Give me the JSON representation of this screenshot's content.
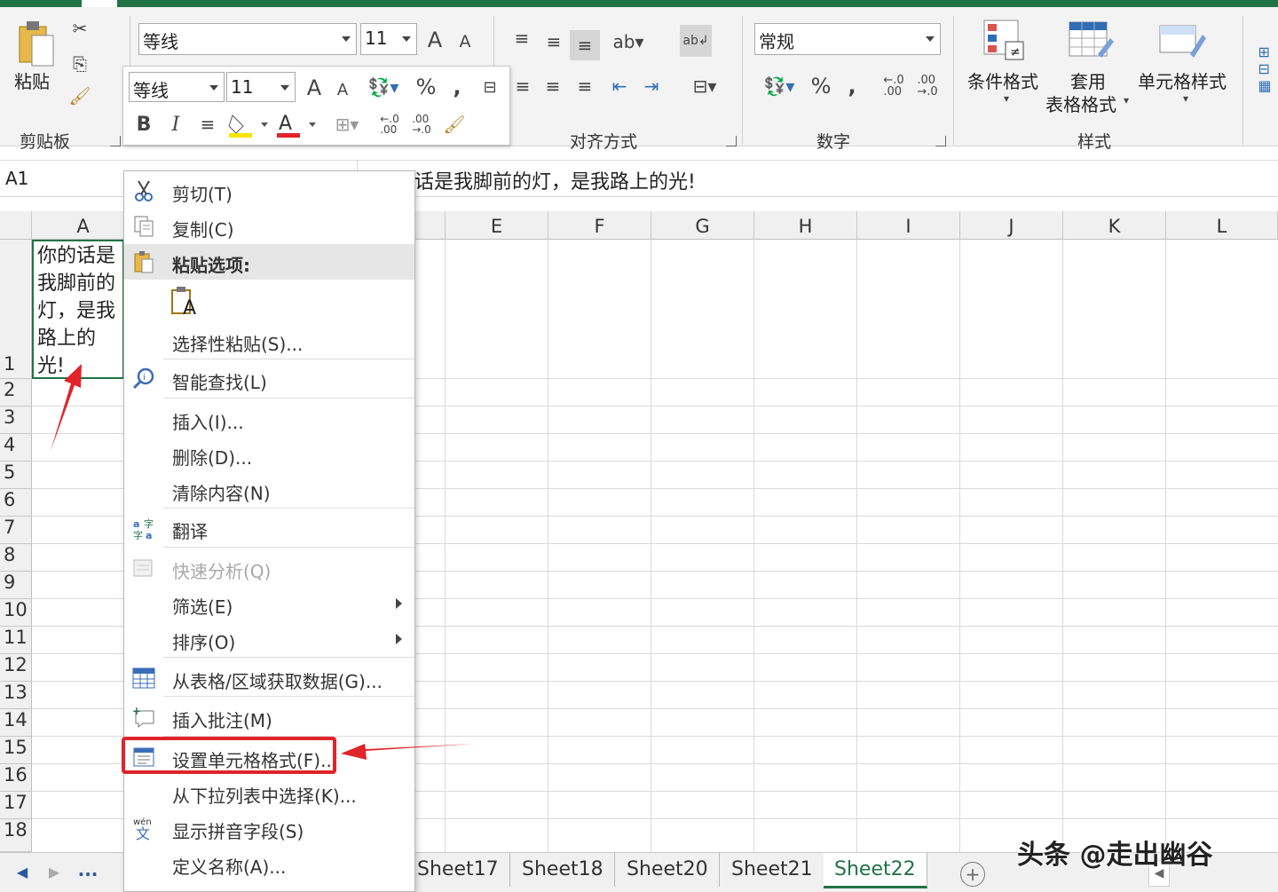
{
  "ribbon": {
    "clipboard": {
      "paste_label": "粘贴",
      "group_label": "剪贴板"
    },
    "font": {
      "font_name": "等线",
      "font_size": "11"
    },
    "alignment": {
      "group_label": "对齐方式"
    },
    "number": {
      "format": "常规",
      "group_label": "数字"
    },
    "styles": {
      "conditional_format": "条件格式",
      "table_format_line1": "套用",
      "table_format_line2": "表格格式",
      "cell_styles": "单元格样式",
      "group_label": "样式"
    }
  },
  "mini_toolbar": {
    "font_name": "等线",
    "font_size": "11"
  },
  "formula_bar": {
    "name_box": "A1",
    "content": "你的话是我脚前的灯，是我路上的光!"
  },
  "grid": {
    "columns": [
      "A",
      "E",
      "F",
      "G",
      "H",
      "I",
      "J",
      "K",
      "L"
    ],
    "rows": [
      "1",
      "2",
      "3",
      "4",
      "5",
      "6",
      "7",
      "8",
      "9",
      "10",
      "11",
      "12",
      "13",
      "14",
      "15",
      "16",
      "17",
      "18"
    ],
    "cell_a1_lines": [
      "你的话是",
      "我脚前的",
      "灯，是我",
      "路上的",
      "光!"
    ]
  },
  "context_menu": {
    "items": [
      {
        "label": "剪切(T)",
        "icon": "scissors-icon"
      },
      {
        "label": "复制(C)",
        "icon": "copy-icon"
      },
      {
        "label": "粘贴选项:",
        "icon": "paste-icon"
      },
      {
        "label": "选择性粘贴(S)..."
      },
      {
        "label": "智能查找(L)",
        "icon": "smart-lookup-icon"
      },
      {
        "label": "插入(I)..."
      },
      {
        "label": "删除(D)..."
      },
      {
        "label": "清除内容(N)"
      },
      {
        "label": "翻译",
        "icon": "translate-icon"
      },
      {
        "label": "快速分析(Q)",
        "icon": "quick-analysis-icon",
        "disabled": true
      },
      {
        "label": "筛选(E)",
        "submenu": true
      },
      {
        "label": "排序(O)",
        "submenu": true
      },
      {
        "label": "从表格/区域获取数据(G)...",
        "icon": "table-icon"
      },
      {
        "label": "插入批注(M)",
        "icon": "comment-icon"
      },
      {
        "label": "设置单元格格式(F)...",
        "icon": "format-cells-icon",
        "highlighted": true
      },
      {
        "label": "从下拉列表中选择(K)..."
      },
      {
        "label": "显示拼音字段(S)",
        "icon": "phonetic-icon"
      },
      {
        "label": "定义名称(A)..."
      }
    ],
    "paste_option_letter": "A"
  },
  "sheet_tabs": {
    "tabs": [
      "Sheet17",
      "Sheet18",
      "Sheet20",
      "Sheet21",
      "Sheet22"
    ],
    "active": "Sheet22",
    "more": "..."
  },
  "watermark": "头条 @走出幽谷",
  "colors": {
    "accent": "#217346",
    "highlight": "#e0242a"
  }
}
